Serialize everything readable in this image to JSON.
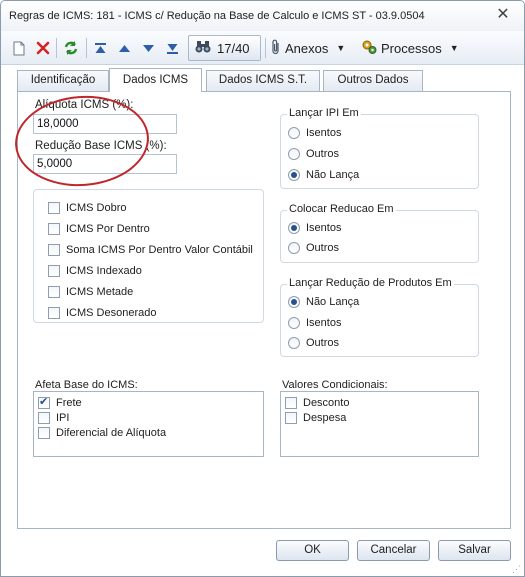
{
  "window": {
    "title": "Regras de ICMS: 181 - ICMS c/ Redução na Base de Calculo e ICMS ST - 03.9.0504",
    "close_label": "✕"
  },
  "toolbar": {
    "counter": "17/40",
    "attachments_label": "Anexos",
    "processes_label": "Processos"
  },
  "tabs": [
    {
      "label": "Identificação",
      "active": false
    },
    {
      "label": "Dados ICMS",
      "active": true
    },
    {
      "label": "Dados ICMS S.T.",
      "active": false
    },
    {
      "label": "Outros Dados",
      "active": false
    }
  ],
  "fields": {
    "aliquota_label": "Alíquota ICMS (%):",
    "aliquota_value": "18,0000",
    "reducao_label": "Redução Base ICMS (%):",
    "reducao_value": "5,0000"
  },
  "icms_options": [
    {
      "label": "ICMS Dobro",
      "checked": false
    },
    {
      "label": "ICMS Por Dentro",
      "checked": false
    },
    {
      "label": "Soma ICMS Por Dentro Valor Contábil",
      "checked": false
    },
    {
      "label": "ICMS Indexado",
      "checked": false
    },
    {
      "label": "ICMS Metade",
      "checked": false
    },
    {
      "label": "ICMS Desonerado",
      "checked": false
    }
  ],
  "lancar_ipi": {
    "title": "Lançar IPI Em",
    "options": [
      {
        "label": "Isentos",
        "checked": false
      },
      {
        "label": "Outros",
        "checked": false
      },
      {
        "label": "Não Lança",
        "checked": true
      }
    ]
  },
  "colocar_reducao": {
    "title": "Colocar Reducao Em",
    "options": [
      {
        "label": "Isentos",
        "checked": true
      },
      {
        "label": "Outros",
        "checked": false
      }
    ]
  },
  "lancar_reducao_produtos": {
    "title": "Lançar Redução de Produtos Em",
    "options": [
      {
        "label": "Não Lança",
        "checked": true
      },
      {
        "label": "Isentos",
        "checked": false
      },
      {
        "label": "Outros",
        "checked": false
      }
    ]
  },
  "afeta_base": {
    "title": "Afeta Base do ICMS:",
    "items": [
      {
        "label": "Frete",
        "checked": true
      },
      {
        "label": "IPI",
        "checked": false
      },
      {
        "label": "Diferencial de Alíquota",
        "checked": false
      }
    ]
  },
  "valores_condicionais": {
    "title": "Valores Condicionais:",
    "items": [
      {
        "label": "Desconto",
        "checked": false
      },
      {
        "label": "Despesa",
        "checked": false
      }
    ]
  },
  "footer": {
    "ok_label": "OK",
    "cancel_label": "Cancelar",
    "save_label": "Salvar"
  },
  "colors": {
    "annotation_circle": "#c0272d",
    "accent": "#2a4f8f"
  }
}
